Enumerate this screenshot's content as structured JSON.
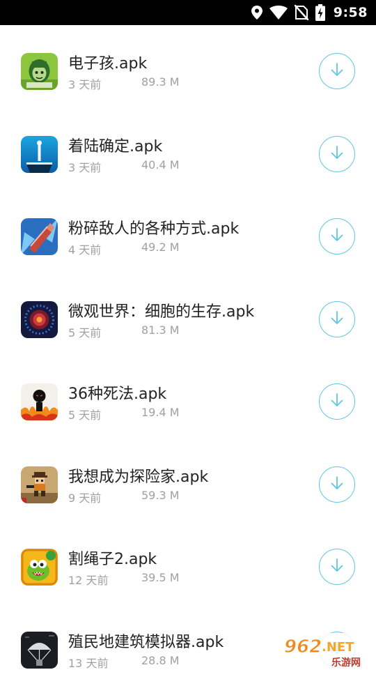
{
  "status_bar": {
    "time": "9:58",
    "icons": [
      "location-icon",
      "wifi-icon",
      "no-sim-icon",
      "battery-charging-icon"
    ]
  },
  "accent_color": "#5ec6e6",
  "downloads": [
    {
      "name": "电子孩.apk",
      "age": "3 天前",
      "size": "89.3 M",
      "icon": "zombie-girl-icon"
    },
    {
      "name": "着陆确定.apk",
      "age": "3 天前",
      "size": "40.4 M",
      "icon": "landing-pillar-icon"
    },
    {
      "name": "粉碎敌人的各种方式.apk",
      "age": "4 天前",
      "size": "49.2 M",
      "icon": "bullet-smash-icon"
    },
    {
      "name": "微观世界：细胞的生存.apk",
      "age": "5 天前",
      "size": "81.3 M",
      "icon": "microbe-cell-icon"
    },
    {
      "name": "36种死法.apk",
      "age": "5 天前",
      "size": "19.4 M",
      "icon": "stickman-fire-icon"
    },
    {
      "name": "我想成为探险家.apk",
      "age": "9 天前",
      "size": "59.3 M",
      "icon": "pixel-explorer-icon"
    },
    {
      "name": "割绳子2.apk",
      "age": "12 天前",
      "size": "39.5 M",
      "icon": "om-nom-icon"
    },
    {
      "name": "殖民地建筑模拟器.apk",
      "age": "13 天前",
      "size": "28.8 M",
      "icon": "colony-parachute-icon"
    }
  ],
  "watermark": {
    "number": "962",
    "suffix": ".NET",
    "subtitle": "乐游网"
  }
}
